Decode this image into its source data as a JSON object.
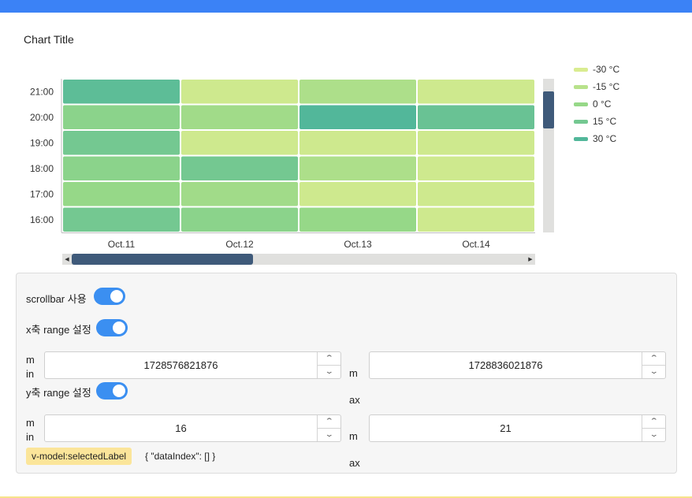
{
  "page": {
    "title": "Chart Title"
  },
  "chart_data": {
    "type": "heatmap",
    "title": "Chart Title",
    "x_categories": [
      "Oct.11",
      "Oct.12",
      "Oct.13",
      "Oct.14"
    ],
    "y_categories": [
      "16:00",
      "17:00",
      "18:00",
      "19:00",
      "20:00",
      "21:00"
    ],
    "values": [
      [
        15,
        5,
        0,
        -25
      ],
      [
        0,
        -5,
        -25,
        -25
      ],
      [
        5,
        15,
        -10,
        -25
      ],
      [
        15,
        -25,
        -25,
        -25
      ],
      [
        5,
        -5,
        30,
        20
      ],
      [
        25,
        -25,
        -10,
        -25
      ]
    ],
    "legend": {
      "position": "right",
      "items": [
        {
          "label": "-30 °C",
          "color": "#d9ec90"
        },
        {
          "label": "-15 °C",
          "color": "#b8e28b"
        },
        {
          "label": "0 °C",
          "color": "#96d888"
        },
        {
          "label": "15 °C",
          "color": "#74c891"
        },
        {
          "label": "30 °C",
          "color": "#52b79a"
        }
      ]
    },
    "colors": {
      "cold": "#d9ec90",
      "hot": "#52b79a",
      "scroll_thumb": "#3f5a7a"
    }
  },
  "controls": {
    "scrollbar_label": "scrollbar 사용",
    "x_range_label": "x축 range 설정",
    "y_range_label": "y축 range 설정",
    "min_label": "m\nin",
    "max_label": "m\nax",
    "x_min_value": "1728576821876",
    "x_max_value": "1728836021876",
    "y_min_value": "16",
    "y_max_value": "21",
    "vmodel_tag": "v-model:selectedLabel",
    "vmodel_value": "{ \"dataIndex\": [] }"
  },
  "colors": {
    "accent_bar": "#3b82f6",
    "toggle": "#3b8ff1",
    "tag": "#fbe59a"
  }
}
